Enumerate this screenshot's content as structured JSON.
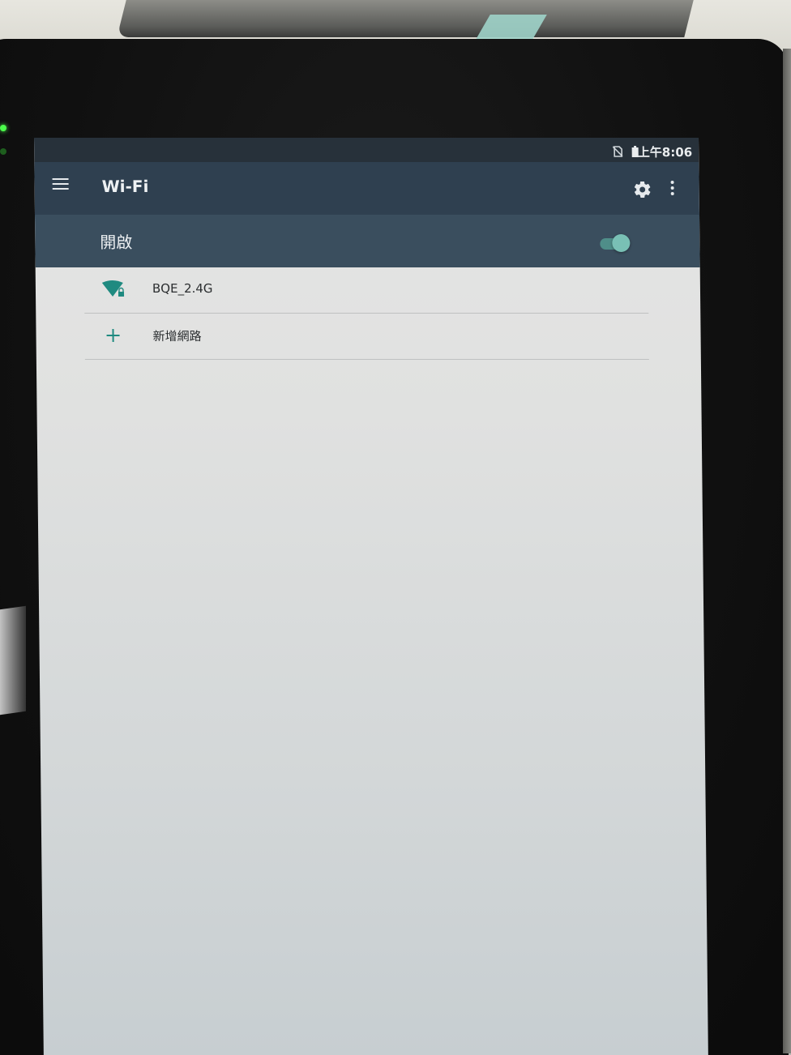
{
  "status_bar": {
    "time": "上午8:06",
    "icons": [
      "no-sim-icon",
      "battery-icon"
    ]
  },
  "toolbar": {
    "title": "Wi-Fi",
    "menu_icon": "hamburger-menu-icon",
    "settings_icon": "gear-icon",
    "overflow_icon": "more-vert-icon"
  },
  "wifi_switch": {
    "label": "開啟",
    "state": "on",
    "accent": "#79c0b5"
  },
  "networks": [
    {
      "ssid": "BQE_2.4G",
      "icon": "wifi-lock-icon",
      "signal_bars": 4,
      "secured": true
    }
  ],
  "add_network": {
    "label": "新增網路",
    "icon": "plus-icon"
  },
  "colors": {
    "status_bar": "#27313a",
    "toolbar": "#2f4050",
    "switch_bar": "#3a4e5e",
    "accent": "#1f8a80"
  }
}
